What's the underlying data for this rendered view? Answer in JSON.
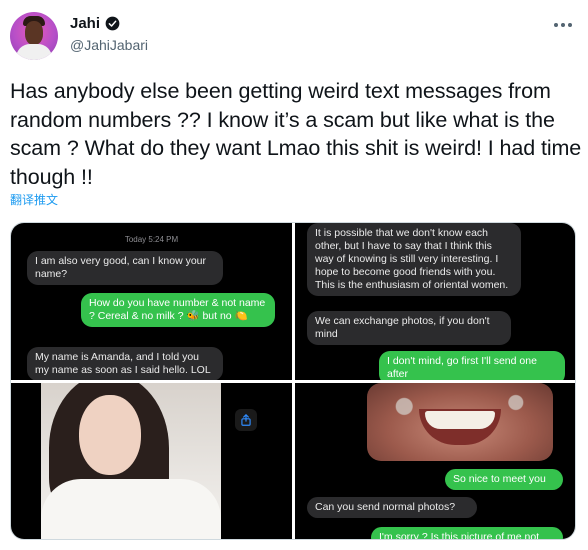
{
  "tweet": {
    "display_name": "Jahi",
    "handle": "@JahiJabari",
    "verified_icon": "verified-badge-icon",
    "text": "Has anybody else been getting weird text messages from random numbers ?? I know it’s a scam but like what is the scam ? What do they want Lmao this shit is weird! I had time though !!",
    "translate_label": "翻译推文"
  },
  "media": {
    "top_left": {
      "timestamp": "Today 5:24 PM",
      "messages": [
        {
          "side": "in",
          "text": "I am also very good, can I know your name?"
        },
        {
          "side": "out",
          "text": "How do you have number & not name ? Cereal & no milk ? 🐝 but no 🍋"
        },
        {
          "side": "in",
          "text": "My name is Amanda, and I told you my name as soon as I said hello. LOL"
        }
      ]
    },
    "top_right": {
      "messages": [
        {
          "side": "in",
          "text": "It is possible that we don't know each other, but I have to say that I think this way of knowing is still very interesting. I hope to become good friends with you. This is the enthusiasm of oriental women."
        },
        {
          "side": "in",
          "text": "We can exchange photos, if you don't mind"
        },
        {
          "side": "out",
          "text": "I don't mind, go first I'll send one after"
        }
      ]
    },
    "bottom_left": {
      "photo_alt_icon": "photo-woman-image",
      "share_icon": "share-icon"
    },
    "bottom_right": {
      "messages": [
        {
          "side": "out",
          "text": "So nice to meet you"
        },
        {
          "side": "in",
          "text": "Can you send normal photos?"
        },
        {
          "side": "out",
          "text": "I'm sorry ? Is this picture of me not"
        }
      ]
    }
  },
  "colors": {
    "ios_green": "#35c24d",
    "ios_gray_bubble": "#2b2b2d",
    "link_blue": "#1d9bf0",
    "secondary_text": "#536471"
  }
}
